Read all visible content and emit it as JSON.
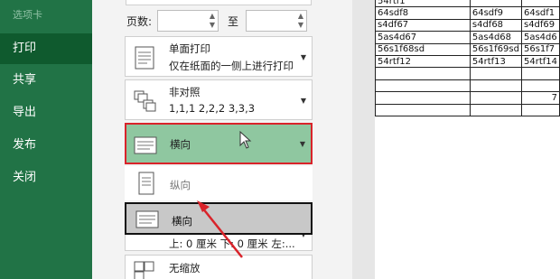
{
  "sidebar": {
    "top_label": "选项卡",
    "items": [
      {
        "label": "打印"
      },
      {
        "label": "共享"
      },
      {
        "label": "导出"
      },
      {
        "label": "发布"
      },
      {
        "label": "关闭"
      }
    ]
  },
  "pages": {
    "label": "页数:",
    "to_label": "至",
    "from_value": "",
    "to_value": ""
  },
  "options": {
    "sides": {
      "line1": "单面打印",
      "line2": "仅在纸面的一侧上进行打印"
    },
    "collate": {
      "line1": "非对照",
      "line2": "1,1,1    2,2,2    3,3,3"
    },
    "orientation": {
      "label": "横向"
    },
    "margins": {
      "line1": "上: 0 厘米 下: 0 厘米 左:..."
    },
    "scaling": {
      "line1": "无缩放"
    }
  },
  "orientation_menu": [
    {
      "label": "纵向"
    },
    {
      "label": "横向"
    }
  ],
  "preview": {
    "rows": [
      [
        "54rtf1",
        "",
        ""
      ],
      [
        "64sdf8",
        "64sdf9",
        "64sdf1"
      ],
      [
        "s4df67",
        "s4df68",
        "s4df69"
      ],
      [
        "5as4d67",
        "5as4d68",
        "5as4d6"
      ],
      [
        "56s1f68sd",
        "56s1f69sd",
        "56s1f7"
      ],
      [
        "54rtf12",
        "54rtf13",
        "54rtf14"
      ],
      [
        "",
        "",
        ""
      ],
      [
        "",
        "",
        ""
      ],
      [
        "",
        "",
        "7"
      ],
      [
        "",
        "",
        ""
      ]
    ]
  },
  "colors": {
    "sidebar": "#217346",
    "selected": "#8fc7a0",
    "highlight_border": "#d9232a",
    "annotation_arrow": "#d9232a"
  }
}
